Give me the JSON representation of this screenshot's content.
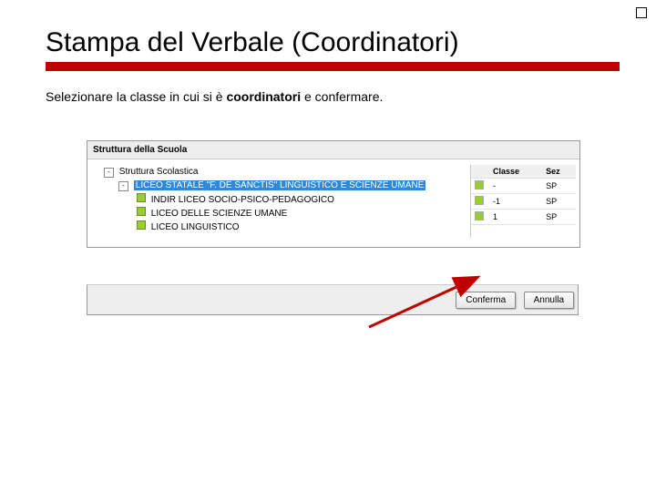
{
  "title": "Stampa del Verbale (Coordinatori)",
  "instruction_pre": "Selezionare la classe in cui si è ",
  "instruction_bold": "coordinatori",
  "instruction_post": " e confermare.",
  "panel": {
    "header": "Struttura della Scuola",
    "root": "Struttura Scolastica",
    "selected": "LICEO STATALE \"F. DE SANCTIS\" LINGUISTICO E SCIENZE UMANE",
    "children": [
      "INDIR LICEO SOCIO-PSICO-PEDAGOGICO",
      "LICEO DELLE SCIENZE UMANE",
      "LICEO LINGUISTICO"
    ]
  },
  "table": {
    "col_classe": "Classe",
    "col_sezione": "Sez",
    "rows": [
      {
        "classe": "-",
        "sez": "SP"
      },
      {
        "classe": "-1",
        "sez": "SP"
      },
      {
        "classe": "1",
        "sez": "SP"
      }
    ]
  },
  "buttons": {
    "confirm": "Conferma",
    "cancel": "Annulla"
  }
}
